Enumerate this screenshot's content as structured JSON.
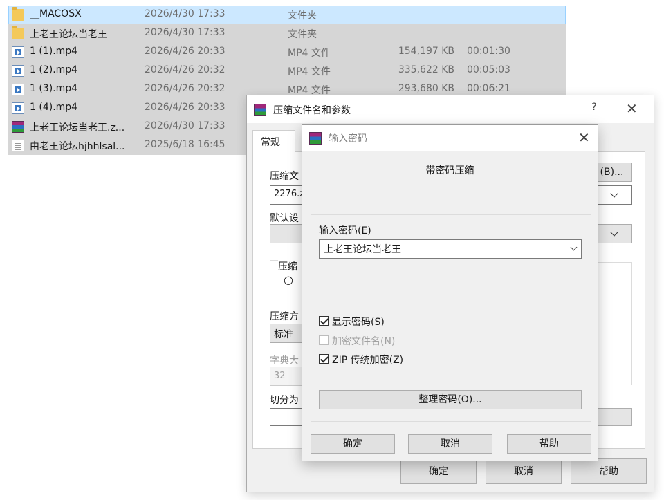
{
  "files": [
    {
      "name": "__MACOSX",
      "date": "2026/4/30 17:33",
      "type": "文件夹",
      "size": "",
      "duration": "",
      "icon": "folder-icon"
    },
    {
      "name": "上老王论坛当老王",
      "date": "2026/4/30 17:33",
      "type": "文件夹",
      "size": "",
      "duration": "",
      "icon": "folder-icon"
    },
    {
      "name": "1 (1).mp4",
      "date": "2026/4/26 20:33",
      "type": "MP4 文件",
      "size": "154,197 KB",
      "duration": "00:01:30",
      "icon": "mp4-file-icon"
    },
    {
      "name": "1 (2).mp4",
      "date": "2026/4/26 20:32",
      "type": "MP4 文件",
      "size": "335,622 KB",
      "duration": "00:05:03",
      "icon": "mp4-file-icon"
    },
    {
      "name": "1 (3).mp4",
      "date": "2026/4/26 20:32",
      "type": "MP4 文件",
      "size": "293,680 KB",
      "duration": "00:06:21",
      "icon": "mp4-file-icon"
    },
    {
      "name": "1 (4).mp4",
      "date": "2026/4/26 20:33",
      "type": "",
      "size": "",
      "duration": "",
      "icon": "mp4-file-icon"
    },
    {
      "name": "上老王论坛当老王.z...",
      "date": "2026/4/30 17:33",
      "type": "",
      "size": "",
      "duration": "",
      "icon": "winrar-archive-icon"
    },
    {
      "name": "由老王论坛hjhhlsal...",
      "date": "2025/6/18 16:45",
      "type": "",
      "size": "",
      "duration": "",
      "icon": "text-file-icon"
    }
  ],
  "archive_dialog": {
    "title": "压缩文件名和参数",
    "help": "?",
    "close": "✕",
    "tab_general": "常规",
    "label_archive_name": "压缩文",
    "archive_name_value": "2276.z",
    "browse_button": "(B)...",
    "label_default": "默认设",
    "label_format": "压缩",
    "radio_partial": "○",
    "label_method": "压缩方",
    "method_value": "标准",
    "label_dict": "字典大",
    "dict_value": "32",
    "label_split": "切分为",
    "ok": "确定",
    "cancel": "取消",
    "help_button": "帮助"
  },
  "password_dialog": {
    "title": "输入密码",
    "close": "✕",
    "heading": "带密码压缩",
    "password_label": "输入密码(E)",
    "password_value": "上老王论坛当老王",
    "show_password": {
      "label": "显示密码(S)",
      "checked": true,
      "enabled": true
    },
    "encrypt_names": {
      "label": "加密文件名(N)",
      "checked": false,
      "enabled": false
    },
    "zip_legacy": {
      "label": "ZIP 传统加密(Z)",
      "checked": true,
      "enabled": true
    },
    "organize_button": "整理密码(O)...",
    "ok": "确定",
    "cancel": "取消",
    "help": "帮助"
  }
}
